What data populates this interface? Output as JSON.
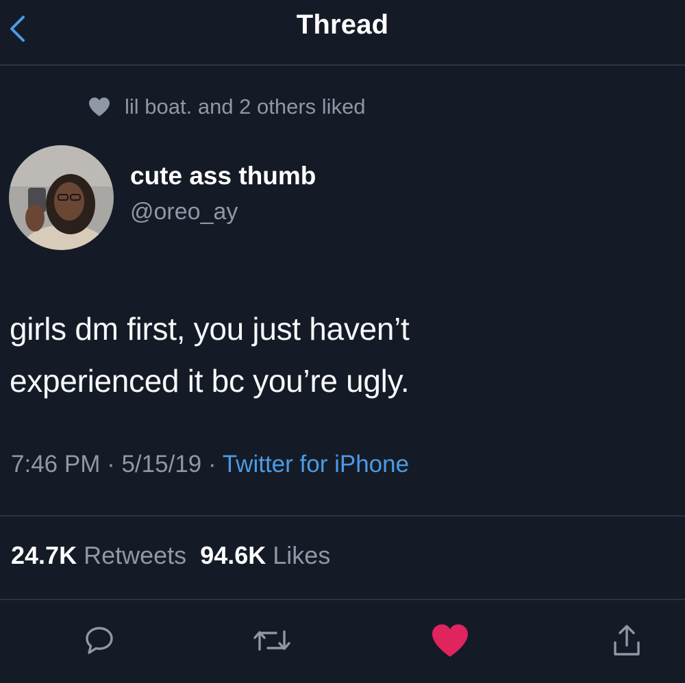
{
  "nav": {
    "title": "Thread",
    "back_icon": "chevron-left-icon"
  },
  "social_context": {
    "icon": "heart-icon",
    "text": "lil boat. and 2 others liked"
  },
  "author": {
    "display_name": "cute ass thumb",
    "handle": "@oreo_ay"
  },
  "tweet": {
    "lines": [
      "girls dm first, you just haven’t",
      "experienced it bc you’re ugly."
    ],
    "time": "7:46 PM",
    "date": "5/15/19",
    "separator": " · ",
    "source": "Twitter for iPhone"
  },
  "stats": {
    "retweets_count": "24.7K",
    "retweets_label": "Retweets",
    "likes_count": "94.6K",
    "likes_label": "Likes"
  },
  "actions": {
    "reply_icon": "reply-icon",
    "retweet_icon": "retweet-icon",
    "like_icon": "heart-icon",
    "share_icon": "share-icon",
    "liked": true
  },
  "colors": {
    "background": "#151b26",
    "text_primary": "#ffffff",
    "text_secondary": "#8e98a7",
    "link": "#4c9be6",
    "like": "#e0245e",
    "divider": "#2c3442"
  }
}
